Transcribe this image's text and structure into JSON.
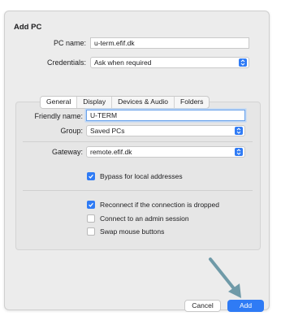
{
  "dialog": {
    "title": "Add PC"
  },
  "pc_name": {
    "label": "PC name:",
    "value": "u-term.efif.dk"
  },
  "credentials": {
    "label": "Credentials:",
    "value": "Ask when required"
  },
  "tabs": [
    {
      "label": "General",
      "selected": true
    },
    {
      "label": "Display",
      "selected": false
    },
    {
      "label": "Devices & Audio",
      "selected": false
    },
    {
      "label": "Folders",
      "selected": false
    }
  ],
  "friendly_name": {
    "label": "Friendly name:",
    "value": "U-TERM"
  },
  "group": {
    "label": "Group:",
    "value": "Saved PCs"
  },
  "gateway": {
    "label": "Gateway:",
    "value": "remote.efif.dk"
  },
  "checkboxes": {
    "bypass": {
      "label": "Bypass for local addresses",
      "checked": true
    },
    "reconnect": {
      "label": "Reconnect if the connection is dropped",
      "checked": true
    },
    "admin": {
      "label": "Connect to an admin session",
      "checked": false
    },
    "swap": {
      "label": "Swap mouse buttons",
      "checked": false
    }
  },
  "buttons": {
    "cancel": "Cancel",
    "add": "Add"
  },
  "colors": {
    "accent": "#2f7bf5",
    "annotation_arrow": "#6f9aa8"
  }
}
